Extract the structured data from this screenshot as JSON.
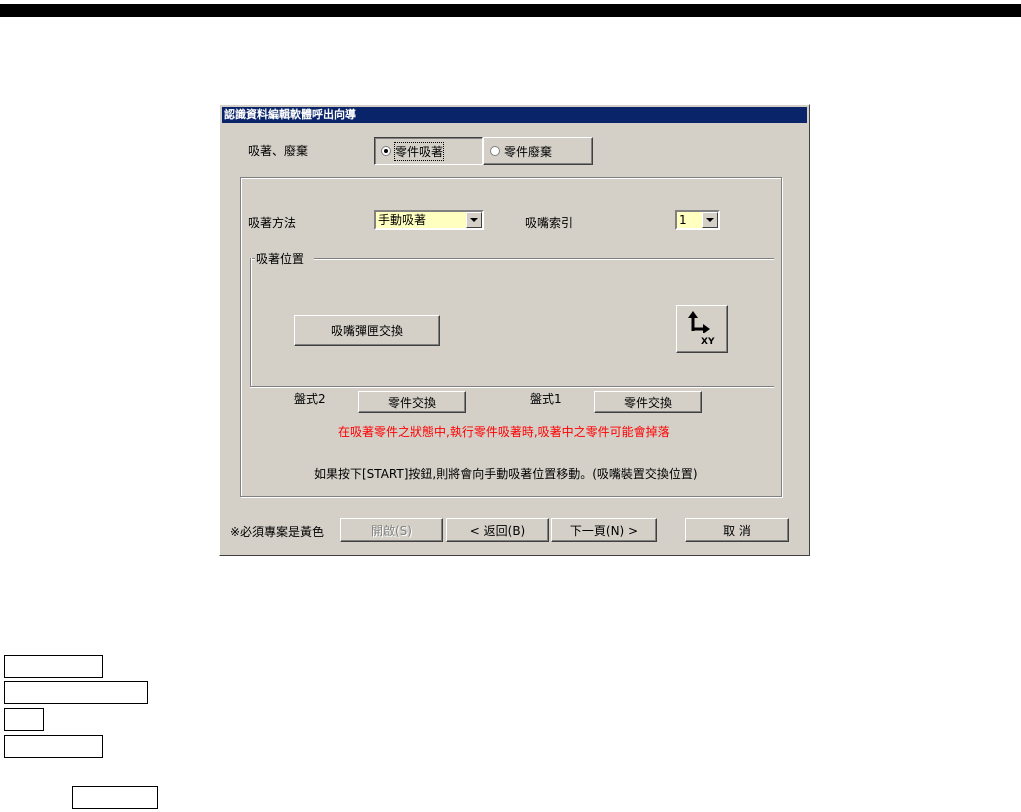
{
  "dialog": {
    "title": "認識資料編輯軟體呼出向導",
    "pick_discard_label": "吸著、廢棄",
    "options": {
      "pick": "零件吸著",
      "discard": "零件廢棄"
    },
    "pick_method_label": "吸著方法",
    "pick_method_value": "手動吸著",
    "nozzle_index_label": "吸嘴索引",
    "nozzle_index_value": "1",
    "pick_position_label": "吸著位置",
    "nozzle_swap_button": "吸嘴彈匣交換",
    "xy_button": "XY",
    "tray2_label": "盤式2",
    "tray2_swap_button": "零件交換",
    "tray1_label": "盤式1",
    "tray1_swap_button": "零件交換",
    "warning_text": "在吸著零件之狀態中,執行零件吸著時,吸著中之零件可能會掉落",
    "info_text": "如果按下[START]按鈕,則將會向手動吸著位置移動。(吸嘴裝置交換位置)",
    "required_note": "※必須專案是黃色",
    "buttons": {
      "open": "開啟(S)",
      "back": "< 返回(B)",
      "next": "下一頁(N) >",
      "cancel": "取 消"
    }
  },
  "colors": {
    "required_field": "#ffffc0",
    "warning": "#ff0000",
    "titlebar": "#0a246a"
  }
}
